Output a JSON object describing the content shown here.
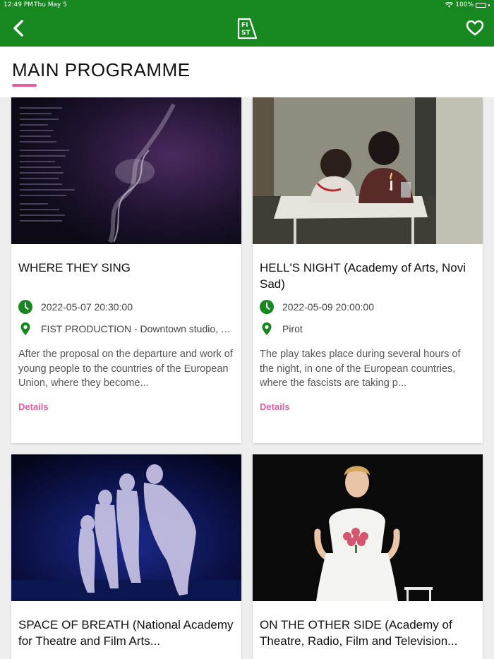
{
  "status": {
    "time": "12:49 PM",
    "date": "Thu May 5",
    "battery": "100%",
    "battery_level": 1.0
  },
  "header": {
    "logo_text": "FIST"
  },
  "page": {
    "title": "MAIN PROGRAMME"
  },
  "colors": {
    "brand_green": "#17871f",
    "accent_pink": "#e55ea2"
  },
  "cards": [
    {
      "title": "WHERE THEY SING",
      "datetime": "2022-05-07 20:30:00",
      "location": "FIST PRODUCTION - Downtown studio, Vi...",
      "description": "After the proposal on the departure and work of young people to the countries of the European Union, where they become...",
      "details_label": "Details"
    },
    {
      "title": "HELL'S NIGHT (Academy of Arts, Novi Sad)",
      "datetime": "2022-05-09 20:00:00",
      "location": "Pirot",
      "description": "The play takes place during several hours of the night, in one of the European countries, where the fascists are taking p...",
      "details_label": "Details"
    },
    {
      "title": "SPACE OF BREATH (National Academy for Theatre and Film Arts...",
      "datetime": "",
      "location": "",
      "description": "",
      "details_label": ""
    },
    {
      "title": "ON THE OTHER SIDE (Academy of Theatre, Radio, Film and Television...",
      "datetime": "",
      "location": "",
      "description": "",
      "details_label": ""
    }
  ]
}
